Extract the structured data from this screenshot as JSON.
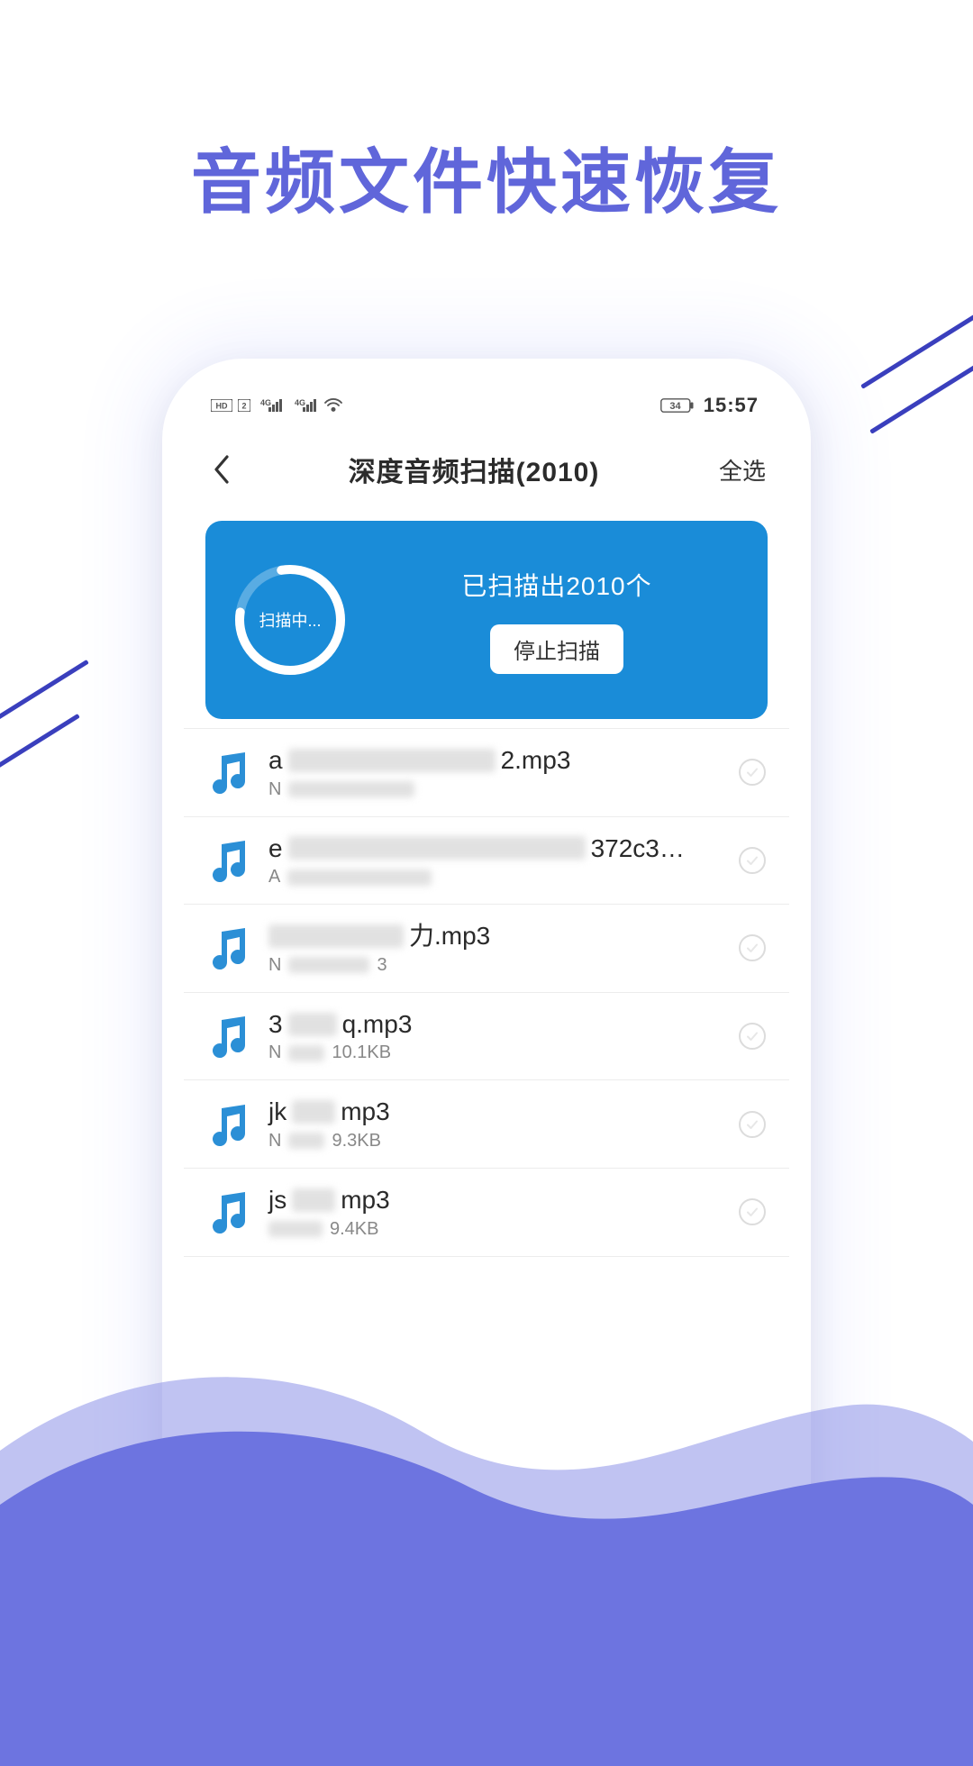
{
  "promo": {
    "title": "音频文件快速恢复"
  },
  "statusbar": {
    "battery": "34",
    "time": "15:57"
  },
  "appbar": {
    "title": "深度音频扫描(2010)",
    "select_all": "全选"
  },
  "scan": {
    "progress_label": "扫描中...",
    "count_text": "已扫描出2010个",
    "stop_label": "停止扫描"
  },
  "rows": [
    {
      "prefix": "a",
      "suffix": "2.mp3",
      "sub_prefix": "N",
      "size": ""
    },
    {
      "prefix": "e",
      "suffix": "372c3…",
      "sub_prefix": "A",
      "size": ""
    },
    {
      "prefix": "",
      "suffix": "力.mp3",
      "sub_prefix": "N",
      "size": "3"
    },
    {
      "prefix": "3",
      "suffix": "q.mp3",
      "sub_prefix": "N",
      "size": "10.1KB"
    },
    {
      "prefix": "jk",
      "suffix": "mp3",
      "sub_prefix": "N",
      "size": "9.3KB"
    },
    {
      "prefix": "js",
      "suffix": "mp3",
      "sub_prefix": "",
      "size": "9.4KB"
    }
  ]
}
